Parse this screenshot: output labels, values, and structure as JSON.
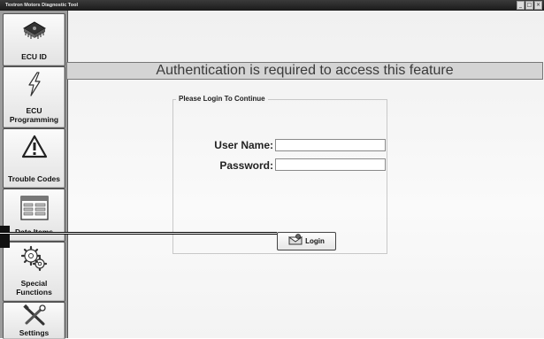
{
  "window": {
    "title": "Textron Motors Diagnostic Tool",
    "controls": [
      "_",
      "□",
      "×"
    ]
  },
  "sidebar": {
    "items": [
      {
        "label": "ECU ID",
        "icon": "chip-icon"
      },
      {
        "label": "ECU Programming",
        "icon": "lightning-icon"
      },
      {
        "label": "Trouble Codes",
        "icon": "warning-icon"
      },
      {
        "label": "Data Items",
        "icon": "data-window-icon"
      },
      {
        "label": "Special Functions",
        "icon": "gears-icon"
      },
      {
        "label": "Settings",
        "icon": "tools-icon"
      }
    ]
  },
  "main": {
    "banner": "Authentication is required to access this feature",
    "login_group": {
      "legend": "Please Login To Continue",
      "username_label": "User Name:",
      "username_value": "",
      "password_label": "Password:",
      "password_value": "",
      "login_button": "Login"
    }
  },
  "colors": {
    "sidebar_bg": "#9c9c9c",
    "banner_bg": "#d4d4d4",
    "titlebar_bg": "#2a2a2a"
  }
}
